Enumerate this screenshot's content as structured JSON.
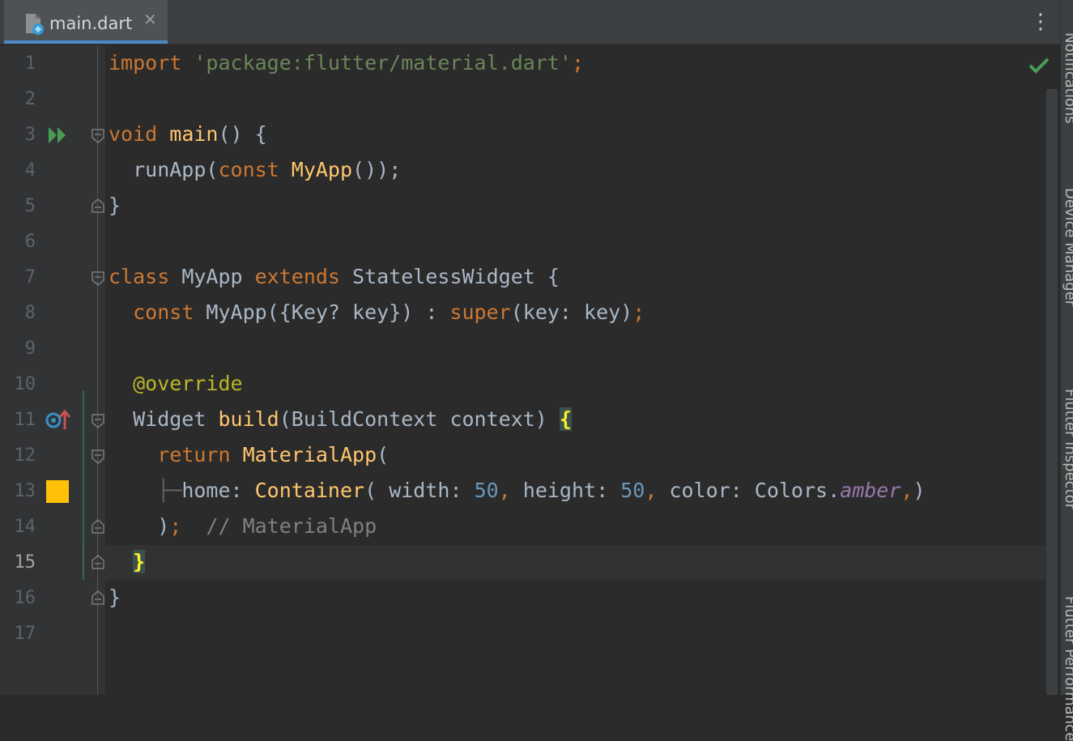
{
  "tab": {
    "file_name": "main.dart",
    "close_glyph": "✕",
    "menu_glyph": "⋮"
  },
  "icons": {
    "file": "dart-file-icon",
    "run": "run-gutter-icon",
    "override": "override-method-icon",
    "color_swatch": "color-swatch-icon",
    "status": "no-problems-check-icon"
  },
  "colors": {
    "background": "#2b2b2b",
    "keyword": "#cc7832",
    "string": "#6a8759",
    "function": "#ffc66d",
    "number": "#6897bb",
    "comment": "#808080",
    "annotation": "#bbb529",
    "swatch_amber": "#ffc107",
    "check": "#499c54"
  },
  "right_rail": {
    "items": [
      "Notifications",
      "Device Manager",
      "Flutter Inspector",
      "Flutter Performance"
    ]
  },
  "code": {
    "lines": [
      {
        "n": "1",
        "parts": {
          "a": "import ",
          "b": "'package:flutter/material.dart'",
          "c": ";"
        }
      },
      {
        "n": "2"
      },
      {
        "n": "3",
        "parts": {
          "a": "void ",
          "b": "main",
          "c": "() {"
        }
      },
      {
        "n": "4",
        "parts": {
          "a": "  runApp(",
          "b": "const ",
          "c": "MyApp",
          "d": "());"
        }
      },
      {
        "n": "5",
        "parts": {
          "a": "}"
        }
      },
      {
        "n": "6"
      },
      {
        "n": "7",
        "parts": {
          "a": "class ",
          "b": "MyApp ",
          "c": "extends ",
          "d": "StatelessWidget {"
        }
      },
      {
        "n": "8",
        "parts": {
          "a": "  ",
          "b": "const ",
          "c": "MyApp({Key? key}) : ",
          "d": "super",
          "e": "(key: key)",
          "f": ";"
        }
      },
      {
        "n": "9"
      },
      {
        "n": "10",
        "parts": {
          "a": "  @override"
        }
      },
      {
        "n": "11",
        "parts": {
          "a": "  Widget ",
          "b": "build",
          "c": "(BuildContext context) ",
          "d": "{"
        }
      },
      {
        "n": "12",
        "parts": {
          "a": "    ",
          "b": "return ",
          "c": "MaterialApp",
          "d": "("
        }
      },
      {
        "n": "13",
        "parts": {
          "a": "    ├─",
          "b": "home: ",
          "c": "Container",
          "d": "( width: ",
          "e": "50",
          "f": ", ",
          "g": "height: ",
          "h": "50",
          "i": ", ",
          "j": "color: Colors.",
          "k": "amber",
          "l": ",",
          "m": ")"
        }
      },
      {
        "n": "14",
        "parts": {
          "a": "    )",
          "b": ";  ",
          "c": "// MaterialApp"
        }
      },
      {
        "n": "15",
        "parts": {
          "a": "  ",
          "b": "}"
        }
      },
      {
        "n": "16",
        "parts": {
          "a": "}"
        }
      },
      {
        "n": "17"
      }
    ]
  }
}
